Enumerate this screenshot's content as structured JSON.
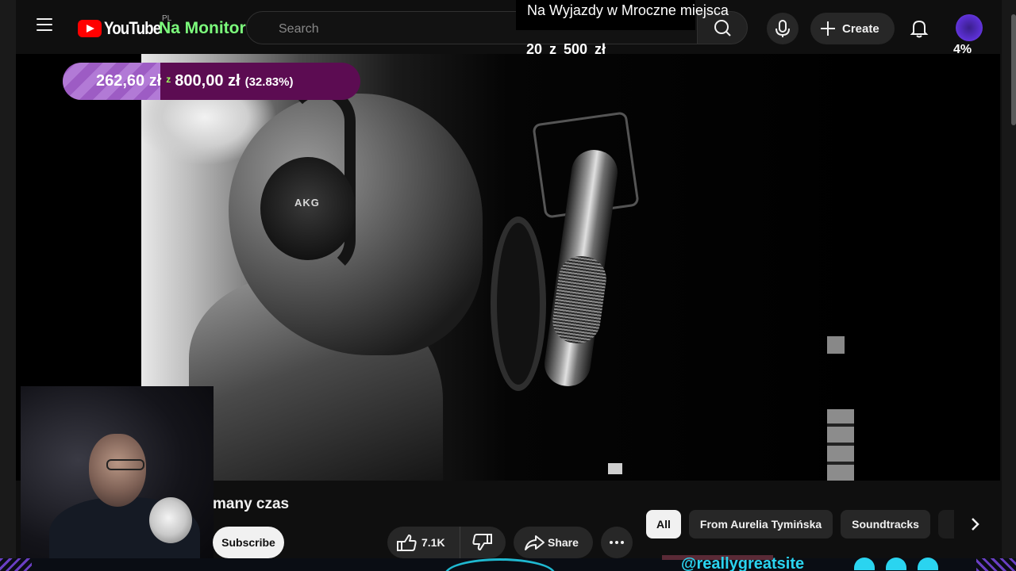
{
  "header": {
    "logo_text": "YouTube",
    "country_code": "PL",
    "search_placeholder": "Search",
    "create_label": "Create"
  },
  "stream_overlay": {
    "channel_name": "Na Monitor",
    "goal_title": "Na Wyjazdy w Mroczne miejsca",
    "goal_progress": "20 z 500 zł",
    "goal_percent": "4%",
    "donation_current": "262,60 zł",
    "donation_separator": "z",
    "donation_goal": "800,00 zł",
    "donation_percent": "(32.83%)",
    "donation_fraction": 0.3283,
    "handle": "@reallygreatsite"
  },
  "video": {
    "title_fragment": "many czas",
    "mic_brand": "AKG"
  },
  "actions": {
    "subscribe_label": "Subscribe",
    "like_count": "7.1K",
    "share_label": "Share"
  },
  "chips": [
    {
      "label": "All",
      "active": true
    },
    {
      "label": "From Aurelia Tymińska",
      "active": false
    },
    {
      "label": "Soundtracks",
      "active": false
    }
  ],
  "icons": {
    "menu": "hamburger-menu-icon",
    "search": "search-icon",
    "mic": "microphone-icon",
    "create": "plus-icon",
    "notifications": "bell-icon",
    "like": "thumbs-up-icon",
    "dislike": "thumbs-down-icon",
    "share": "share-arrow-icon",
    "more": "more-horizontal-icon",
    "next": "chevron-right-icon"
  },
  "colors": {
    "brand_red": "#ff0000",
    "background": "#0f0f0f",
    "channel_green": "#7CFC7C",
    "donation_purple": "#9d5cc4",
    "handle_cyan": "#2ad4f0"
  }
}
